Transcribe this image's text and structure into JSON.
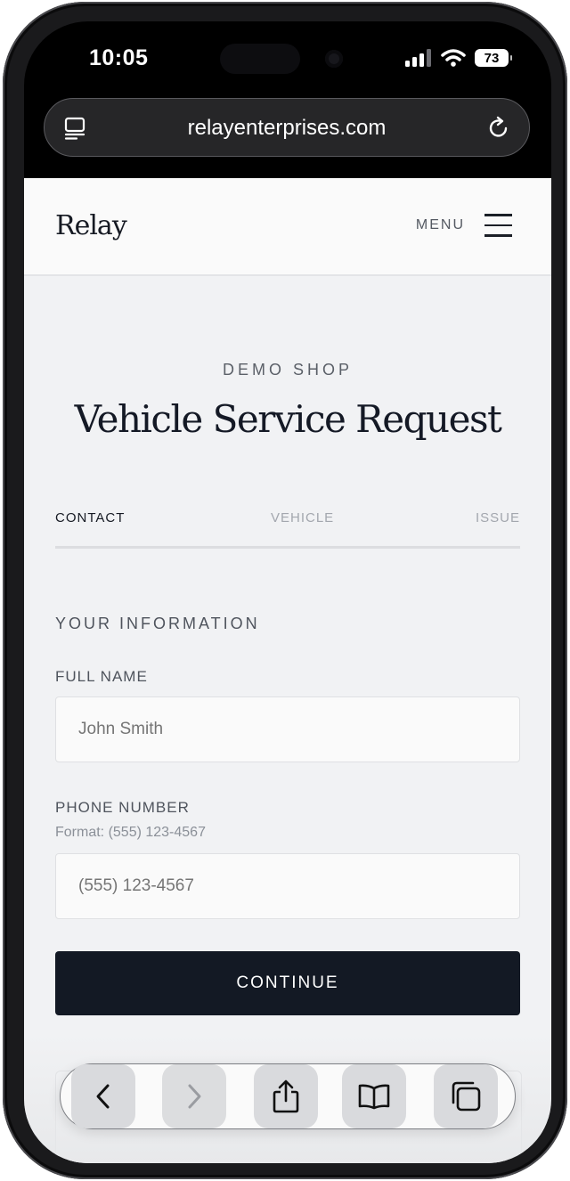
{
  "status_bar": {
    "time": "10:05",
    "battery": "73"
  },
  "browser": {
    "url": "relayenterprises.com"
  },
  "header": {
    "logo": "Relay",
    "menu_label": "MENU"
  },
  "hero": {
    "eyebrow": "DEMO SHOP",
    "title": "Vehicle Service Request"
  },
  "steps": [
    {
      "label": "CONTACT",
      "active": true
    },
    {
      "label": "VEHICLE",
      "active": false
    },
    {
      "label": "ISSUE",
      "active": false
    }
  ],
  "form": {
    "section_label": "YOUR INFORMATION",
    "full_name": {
      "label": "FULL NAME",
      "placeholder": "John Smith",
      "value": ""
    },
    "phone": {
      "label": "PHONE NUMBER",
      "hint": "Format: (555) 123-4567",
      "placeholder": "(555) 123-4567",
      "value": ""
    },
    "continue_label": "CONTINUE"
  },
  "toolbar": {
    "items": [
      "back-icon",
      "forward-icon",
      "share-icon",
      "bookmarks-icon",
      "tabs-icon"
    ]
  },
  "colors": {
    "primary": "#131924",
    "page_bg": "#f1f2f4",
    "muted": "#a3a7ae"
  }
}
